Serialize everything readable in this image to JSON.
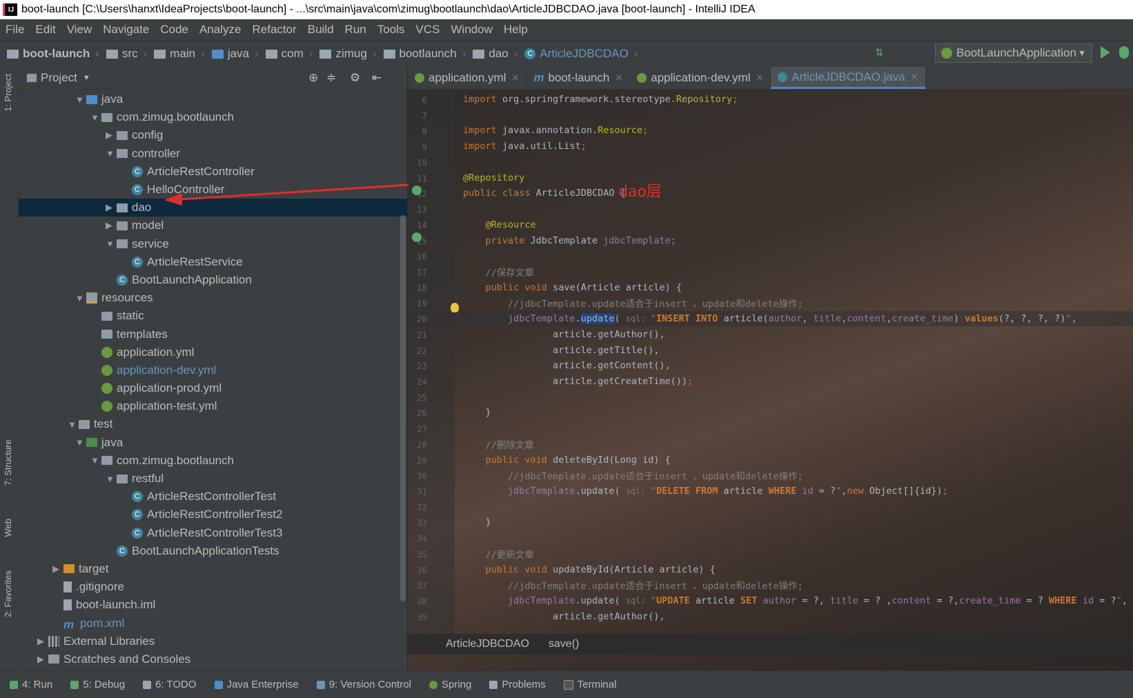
{
  "window": {
    "title": "boot-launch [C:\\Users\\hanxt\\IdeaProjects\\boot-launch] - ...\\src\\main\\java\\com\\zimug\\bootlaunch\\dao\\ArticleJDBCDAO.java [boot-launch] - IntelliJ IDEA",
    "app_icon": "IJ"
  },
  "menu": [
    "File",
    "Edit",
    "View",
    "Navigate",
    "Code",
    "Analyze",
    "Refactor",
    "Build",
    "Run",
    "Tools",
    "VCS",
    "Window",
    "Help"
  ],
  "breadcrumbs": [
    "boot-launch",
    "src",
    "main",
    "java",
    "com",
    "zimug",
    "bootlaunch",
    "dao",
    "ArticleJDBCDAO"
  ],
  "run_config": "BootLaunchApplication",
  "left_strip": {
    "project": "1: Project",
    "structure": "7: Structure",
    "web": "Web",
    "favorites": "2: Favorites"
  },
  "project_panel": {
    "title": "Project",
    "tree": [
      {
        "label": "java",
        "indent": 1,
        "arrow": "▼",
        "icon": "folder-blue"
      },
      {
        "label": "com.zimug.bootlaunch",
        "indent": 2,
        "arrow": "▼",
        "icon": "folder"
      },
      {
        "label": "config",
        "indent": 3,
        "arrow": "▶",
        "icon": "folder"
      },
      {
        "label": "controller",
        "indent": 3,
        "arrow": "▼",
        "icon": "folder"
      },
      {
        "label": "ArticleRestController",
        "indent": 4,
        "arrow": "",
        "icon": "class"
      },
      {
        "label": "HelloController",
        "indent": 4,
        "arrow": "",
        "icon": "class"
      },
      {
        "label": "dao",
        "indent": 3,
        "arrow": "▶",
        "icon": "folder",
        "selected": true
      },
      {
        "label": "model",
        "indent": 3,
        "arrow": "▶",
        "icon": "folder"
      },
      {
        "label": "service",
        "indent": 3,
        "arrow": "▼",
        "icon": "folder"
      },
      {
        "label": "ArticleRestService",
        "indent": 4,
        "arrow": "",
        "icon": "class"
      },
      {
        "label": "BootLaunchApplication",
        "indent": 3,
        "arrow": "",
        "icon": "class"
      },
      {
        "label": "resources",
        "indent": 1,
        "arrow": "▼",
        "icon": "folder-res"
      },
      {
        "label": "static",
        "indent": 2,
        "arrow": "",
        "icon": "folder"
      },
      {
        "label": "templates",
        "indent": 2,
        "arrow": "",
        "icon": "folder"
      },
      {
        "label": "application.yml",
        "indent": 2,
        "arrow": "",
        "icon": "spring"
      },
      {
        "label": "application-dev.yml",
        "indent": 2,
        "arrow": "",
        "icon": "spring",
        "blue": true
      },
      {
        "label": "application-prod.yml",
        "indent": 2,
        "arrow": "",
        "icon": "spring"
      },
      {
        "label": "application-test.yml",
        "indent": 2,
        "arrow": "",
        "icon": "spring"
      },
      {
        "label": "test",
        "indent": 0.5,
        "arrow": "▼",
        "icon": "folder"
      },
      {
        "label": "java",
        "indent": 1,
        "arrow": "▼",
        "icon": "folder-green"
      },
      {
        "label": "com.zimug.bootlaunch",
        "indent": 2,
        "arrow": "▼",
        "icon": "folder"
      },
      {
        "label": "restful",
        "indent": 3,
        "arrow": "▼",
        "icon": "folder"
      },
      {
        "label": "ArticleRestControllerTest",
        "indent": 4,
        "arrow": "",
        "icon": "class"
      },
      {
        "label": "ArticleRestControllerTest2",
        "indent": 4,
        "arrow": "",
        "icon": "class"
      },
      {
        "label": "ArticleRestControllerTest3",
        "indent": 4,
        "arrow": "",
        "icon": "class"
      },
      {
        "label": "BootLaunchApplicationTests",
        "indent": 3,
        "arrow": "",
        "icon": "class"
      },
      {
        "label": "target",
        "indent": -0.5,
        "arrow": "▶",
        "icon": "folder-orange"
      },
      {
        "label": ".gitignore",
        "indent": -0.5,
        "arrow": "",
        "icon": "file"
      },
      {
        "label": "boot-launch.iml",
        "indent": -0.5,
        "arrow": "",
        "icon": "file"
      },
      {
        "label": "pom.xml",
        "indent": -0.5,
        "arrow": "",
        "icon": "maven",
        "blue": true
      },
      {
        "label": "External Libraries",
        "indent": -1.5,
        "arrow": "▶",
        "icon": "lib"
      },
      {
        "label": "Scratches and Consoles",
        "indent": -1.5,
        "arrow": "▶",
        "icon": "folder"
      }
    ]
  },
  "editor_tabs": [
    {
      "label": "application.yml",
      "icon": "spring"
    },
    {
      "label": "boot-launch",
      "icon": "maven"
    },
    {
      "label": "application-dev.yml",
      "icon": "spring"
    },
    {
      "label": "ArticleJDBCDAO.java",
      "icon": "class",
      "active": true
    }
  ],
  "annotation_note": "dao层",
  "code_breadcrumb": [
    "ArticleJDBCDAO",
    "save()"
  ],
  "status_tools": [
    "4: Run",
    "5: Debug",
    "6: TODO",
    "Java Enterprise",
    "9: Version Control",
    "Spring",
    "Problems",
    "Terminal"
  ],
  "colors": {
    "accent": "#4a88c7",
    "selected_row": "#0d293e",
    "annotation": "#e02e2e",
    "run_green": "#59a869"
  }
}
